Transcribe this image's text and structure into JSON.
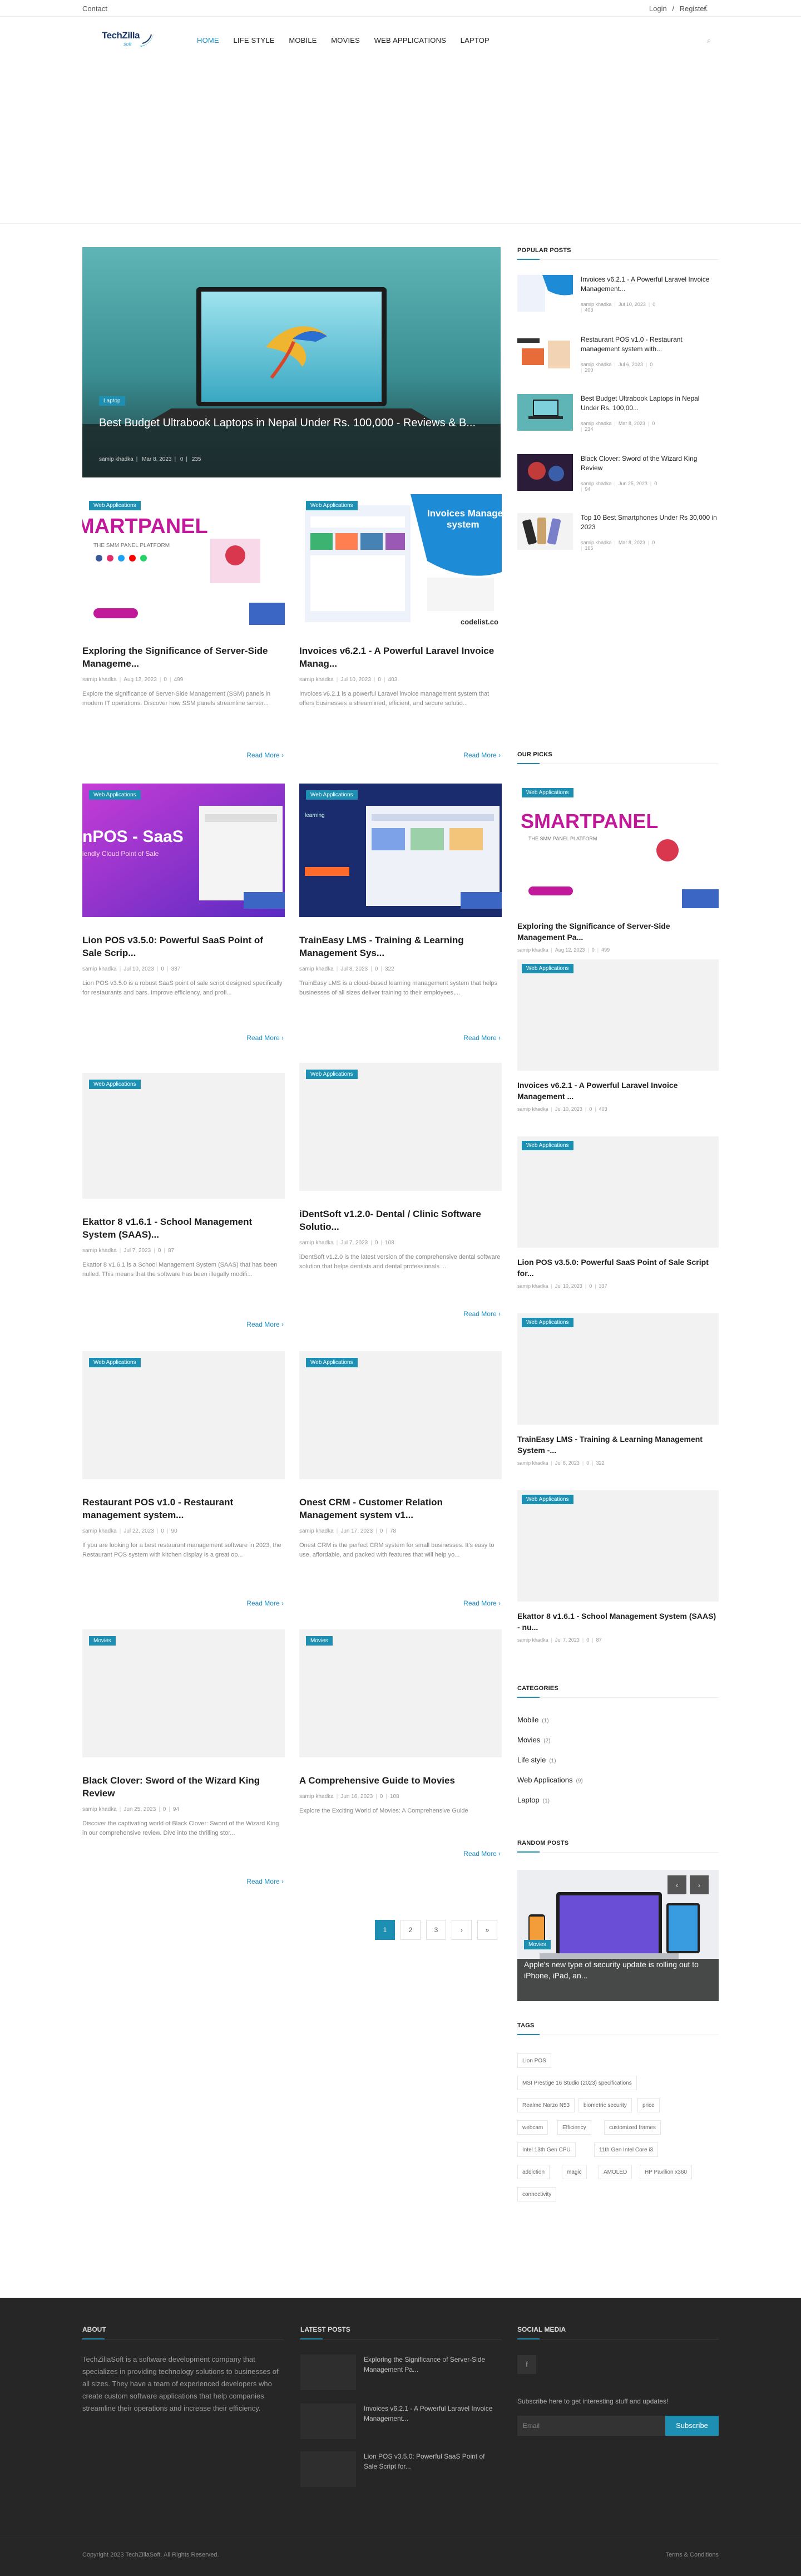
{
  "topbar": {
    "contact": "Contact",
    "login": "Login",
    "sep": "/",
    "register": "Register"
  },
  "logo": {
    "title": "TechZilla",
    "sub": "soft"
  },
  "nav": [
    "HOME",
    "LIFE STYLE",
    "MOBILE",
    "MOVIES",
    "WEB APPLICATIONS",
    "LAPTOP"
  ],
  "feature": {
    "category": "Laptop",
    "title": "Best Budget Ultrabook Laptops in Nepal Under Rs. 100,000 - Reviews & B...",
    "author": "samip khadka",
    "date": "Mar 8, 2023",
    "comments": "0",
    "views": "235"
  },
  "posts": [
    {
      "category": "Web Applications",
      "title": "Exploring the Significance of Server-Side Manageme...",
      "author": "samip khadka",
      "date": "Aug 12, 2023",
      "comments": "0",
      "views": "499",
      "excerpt": "Explore the significance of Server-Side Management (SSM) panels in modern IT operations. Discover how SSM panels streamline server...",
      "more": "Read More"
    },
    {
      "category": "Web Applications",
      "title": "Invoices v6.2.1 - A Powerful Laravel Invoice Manag...",
      "author": "samip khadka",
      "date": "Jul 10, 2023",
      "comments": "0",
      "views": "403",
      "excerpt": "Invoices v6.2.1 is a powerful Laravel invoice management system that offers businesses a streamlined, efficient, and secure solutio...",
      "more": "Read More"
    },
    {
      "category": "Web Applications",
      "title": "Lion POS v3.5.0: Powerful SaaS Point of Sale Scrip...",
      "author": "samip khadka",
      "date": "Jul 10, 2023",
      "comments": "0",
      "views": "337",
      "excerpt": "Lion POS v3.5.0 is a robust SaaS point of sale script designed specifically for restaurants and bars. Improve efficiency, and profi...",
      "more": "Read More"
    },
    {
      "category": "Web Applications",
      "title": "TrainEasy LMS - Training & Learning Management Sys...",
      "author": "samip khadka",
      "date": "Jul 8, 2023",
      "comments": "0",
      "views": "322",
      "excerpt": "TrainEasy LMS is a cloud-based learning management system that helps businesses of all sizes deliver training to their employees,...",
      "more": "Read More"
    },
    {
      "category": "Web Applications",
      "title": "Ekattor 8 v1.6.1 - School Management System (SAAS)...",
      "author": "samip khadka",
      "date": "Jul 7, 2023",
      "comments": "0",
      "views": "87",
      "excerpt": "Ekattor 8 v1.6.1 is a School Management System (SAAS) that has been nulled. This means that the software has been illegally modifi...",
      "more": "Read More"
    },
    {
      "category": "Web Applications",
      "title": "iDentSoft v1.2.0- Dental / Clinic Software Solutio...",
      "author": "samip khadka",
      "date": "Jul 7, 2023",
      "comments": "0",
      "views": "108",
      "excerpt": "iDentSoft v1.2.0 is the latest version of the comprehensive dental software solution that helps dentists and dental professionals ...",
      "more": "Read More"
    },
    {
      "category": "Web Applications",
      "title": "Restaurant POS v1.0 - Restaurant management system...",
      "author": "samip khadka",
      "date": "Jul 22, 2023",
      "comments": "0",
      "views": "90",
      "excerpt": "If you are looking for a best restaurant management software in 2023, the Restaurant POS system with kitchen display is a great op...",
      "more": "Read More"
    },
    {
      "category": "Web Applications",
      "title": "Onest CRM - Customer Relation Management system v1...",
      "author": "samip khadka",
      "date": "Jun 17, 2023",
      "comments": "0",
      "views": "78",
      "excerpt": "Onest CRM is the perfect CRM system for small businesses. It's easy to use, affordable, and packed with features that will help yo...",
      "more": "Read More"
    },
    {
      "category": "Movies",
      "title": "Black Clover: Sword of the Wizard King Review",
      "author": "samip khadka",
      "date": "Jun 25, 2023",
      "comments": "0",
      "views": "94",
      "excerpt": "Discover the captivating world of Black Clover: Sword of the Wizard King in our comprehensive review. Dive into the thrilling stor...",
      "more": "Read More"
    },
    {
      "category": "Movies",
      "title": "A Comprehensive Guide to Movies",
      "author": "samip khadka",
      "date": "Jun 16, 2023",
      "comments": "0",
      "views": "108",
      "excerpt": "Explore the Exciting World of Movies: A Comprehensive Guide",
      "more": "Read More"
    }
  ],
  "pagination": [
    "1",
    "2",
    "3",
    "›",
    "»"
  ],
  "popular": {
    "heading": "POPULAR POSTS",
    "items": [
      {
        "title": "Invoices v6.2.1 - A Powerful Laravel Invoice Management...",
        "author": "samip khadka",
        "date": "Jul 10, 2023",
        "comments": "0",
        "views": "403"
      },
      {
        "title": "Restaurant POS v1.0 - Restaurant management system with...",
        "author": "samip khadka",
        "date": "Jul 6, 2023",
        "comments": "0",
        "views": "200"
      },
      {
        "title": "Best Budget Ultrabook Laptops in Nepal Under Rs. 100,00...",
        "author": "samip khadka",
        "date": "Mar 8, 2023",
        "comments": "0",
        "views": "234"
      },
      {
        "title": "Black Clover: Sword of the Wizard King Review",
        "author": "samip khadka",
        "date": "Jun 25, 2023",
        "comments": "0",
        "views": "94"
      },
      {
        "title": "Top 10 Best Smartphones Under Rs 30,000 in 2023",
        "author": "samip khadka",
        "date": "Mar 8, 2023",
        "comments": "0",
        "views": "165"
      }
    ]
  },
  "picks": {
    "heading": "OUR PICKS",
    "items": [
      {
        "category": "Web Applications",
        "title": "Exploring the Significance of Server-Side Management Pa...",
        "author": "samip khadka",
        "date": "Aug 12, 2023",
        "comments": "0",
        "views": "499"
      },
      {
        "category": "Web Applications",
        "title": "Invoices v6.2.1 - A Powerful Laravel Invoice Management ...",
        "author": "samip khadka",
        "date": "Jul 10, 2023",
        "comments": "0",
        "views": "403"
      },
      {
        "category": "Web Applications",
        "title": "Lion POS v3.5.0: Powerful SaaS Point of Sale Script for...",
        "author": "samip khadka",
        "date": "Jul 10, 2023",
        "comments": "0",
        "views": "337"
      },
      {
        "category": "Web Applications",
        "title": "TrainEasy LMS - Training & Learning Management System -...",
        "author": "samip khadka",
        "date": "Jul 8, 2023",
        "comments": "0",
        "views": "322"
      },
      {
        "category": "Web Applications",
        "title": "Ekattor 8 v1.6.1 - School Management System (SAAS) - nu...",
        "author": "samip khadka",
        "date": "Jul 7, 2023",
        "comments": "0",
        "views": "87"
      }
    ]
  },
  "categories": {
    "heading": "CATEGORIES",
    "items": [
      {
        "label": "Mobile",
        "count": "(1)"
      },
      {
        "label": "Movies",
        "count": "(2)"
      },
      {
        "label": "Life style",
        "count": "(1)"
      },
      {
        "label": "Web Applications",
        "count": "(9)"
      },
      {
        "label": "Laptop",
        "count": "(1)"
      }
    ]
  },
  "random": {
    "heading": "RANDOM POSTS",
    "category": "Movies",
    "title": "Apple's new type of security update is rolling out to iPhone, iPad, an..."
  },
  "tags": {
    "heading": "TAGS",
    "items": [
      "Lion POS",
      "MSI Prestige 16 Studio (2023) specifications",
      "Realme Narzo N53",
      "biometric security",
      "price",
      "webcam",
      "Efficiency",
      "customized frames",
      "Intel 13th Gen CPU",
      "11th Gen Intel Core i3",
      "addiction",
      "magic",
      "AMOLED",
      "HP Pavilion x360",
      "connectivity"
    ]
  },
  "footer": {
    "about_heading": "ABOUT",
    "about_text": "TechZillaSoft is a software development company that specializes in providing technology solutions to businesses of all sizes. They have a team of experienced developers who create custom software applications that help companies streamline their operations and increase their efficiency.",
    "latest_heading": "LATEST POSTS",
    "latest": [
      "Exploring the Significance of Server-Side Management Pa...",
      "Invoices v6.2.1 - A Powerful Laravel Invoice Management...",
      "Lion POS v3.5.0: Powerful SaaS Point of Sale Script for..."
    ],
    "social_heading": "SOCIAL MEDIA",
    "social_icon": "f",
    "subscribe_text": "Subscribe here to get interesting stuff and updates!",
    "email_placeholder": "Email",
    "subscribe_button": "Subscribe",
    "copyright": "Copyright 2023 TechZillaSoft. All Rights Reserved.",
    "terms": "Terms & Conditions"
  },
  "colors": {
    "accent": "#1c8fb2",
    "footer_bg": "#262626"
  },
  "icons": [
    "moon-icon",
    "search-icon",
    "facebook-icon",
    "chevron-left-icon",
    "chevron-right-icon"
  ]
}
